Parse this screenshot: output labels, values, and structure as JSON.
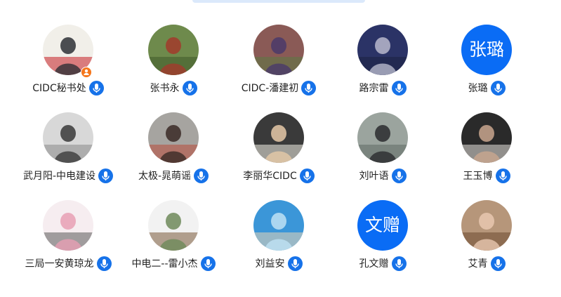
{
  "members": [
    {
      "name": "CIDC秘书处",
      "avatar": "photo",
      "photo_colors": [
        "#f1efe9",
        "#2e3036",
        "#c41e24"
      ],
      "host": true
    },
    {
      "name": "张书永",
      "avatar": "photo",
      "photo_colors": [
        "#6e8a4c",
        "#a23a2c",
        "#3f5a2a"
      ]
    },
    {
      "name": "CIDC-潘建初",
      "avatar": "photo",
      "photo_colors": [
        "#8a5a56",
        "#4a3a6a",
        "#5b7a44"
      ]
    },
    {
      "name": "路宗雷",
      "avatar": "photo",
      "photo_colors": [
        "#2b3366",
        "#b8b9cc",
        "#1c2040"
      ]
    },
    {
      "name": "张璐",
      "avatar": "text",
      "avatar_text": "张璐"
    },
    {
      "name": "武月阳-中电建设",
      "avatar": "photo",
      "photo_colors": [
        "#d8d8d8",
        "#3a3a3a",
        "#8a8a8a"
      ]
    },
    {
      "name": "太极-晁萌谣",
      "avatar": "photo",
      "photo_colors": [
        "#a6a4a0",
        "#3a2a26",
        "#b84a3a"
      ]
    },
    {
      "name": "李丽华CIDC",
      "avatar": "photo",
      "photo_colors": [
        "#3a3a3a",
        "#e6c9a8",
        "#f2f0e6"
      ]
    },
    {
      "name": "刘叶语",
      "avatar": "photo",
      "photo_colors": [
        "#9ba49e",
        "#2a2c2e",
        "#5e6a64"
      ]
    },
    {
      "name": "王玉博",
      "avatar": "photo",
      "photo_colors": [
        "#2a2a2a",
        "#c9a68e",
        "#e6e2dc"
      ]
    },
    {
      "name": "三局一安黄琼龙",
      "avatar": "photo",
      "photo_colors": [
        "#f6edf0",
        "#e79fb4",
        "#5a5a5a"
      ]
    },
    {
      "name": "中电二--雷小杰",
      "avatar": "photo",
      "photo_colors": [
        "#f2f2f2",
        "#6e8a5a",
        "#7a5a3a"
      ]
    },
    {
      "name": "刘益安",
      "avatar": "photo",
      "photo_colors": [
        "#3b96d8",
        "#bfe2f4",
        "#e8d6b8"
      ]
    },
    {
      "name": "孔文赠",
      "avatar": "text",
      "avatar_text": "文赠"
    },
    {
      "name": "艾青",
      "avatar": "photo",
      "photo_colors": [
        "#b6967a",
        "#e9c8b0",
        "#6b4a30"
      ]
    }
  ],
  "icons": {
    "mic": "microphone-icon",
    "host": "host-person-icon"
  },
  "colors": {
    "accent": "#1672e9",
    "text_avatar_bg": "#0a6cf5",
    "host_badge": "#f5761b"
  }
}
